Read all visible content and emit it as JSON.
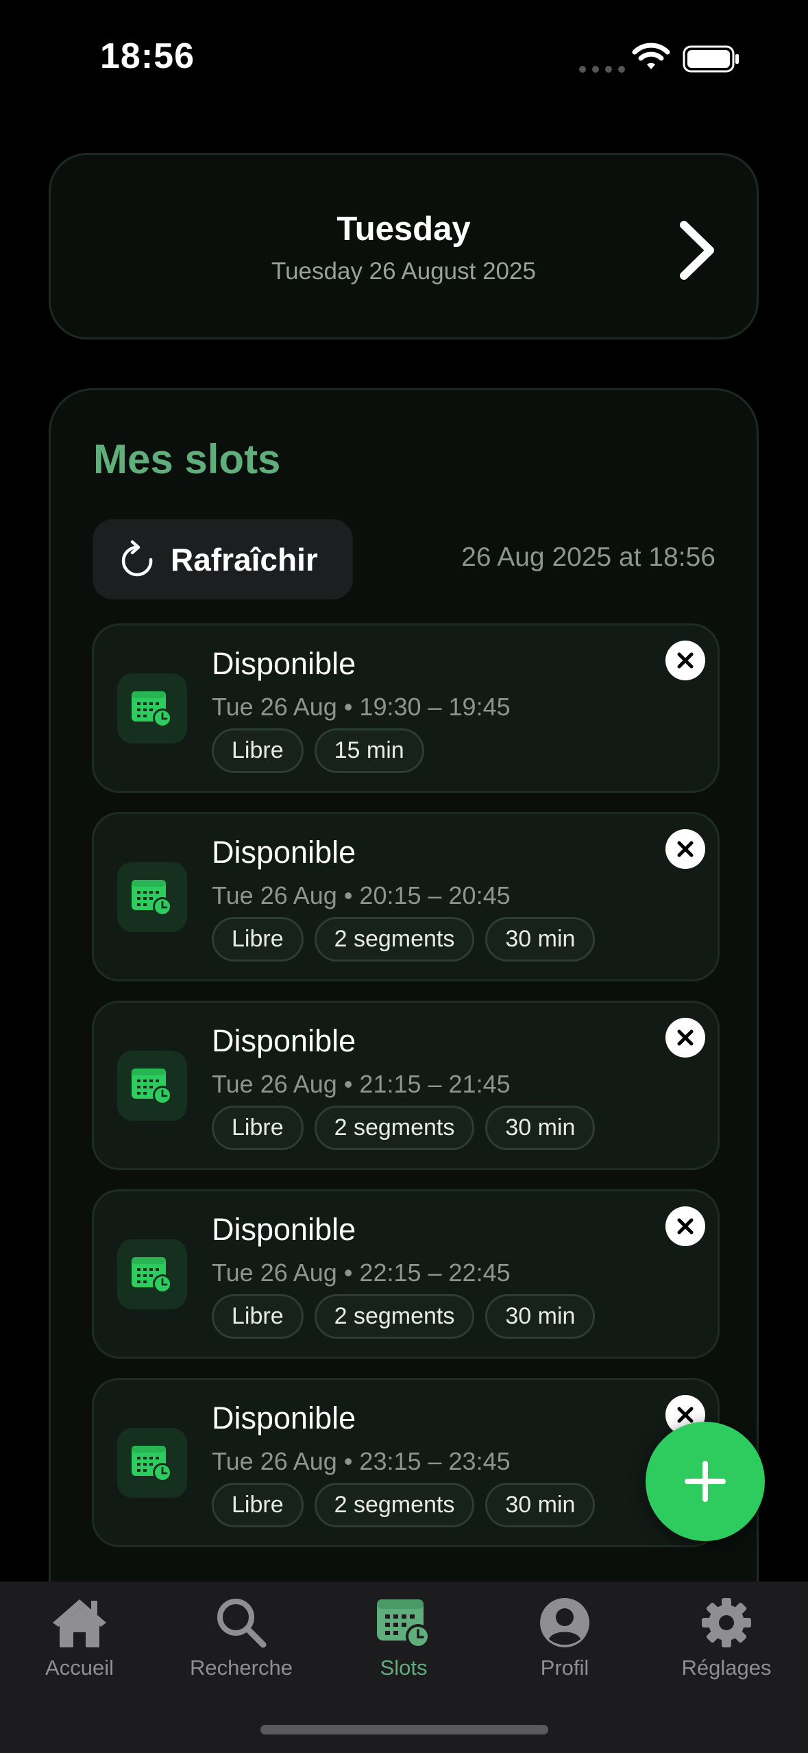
{
  "status_bar": {
    "time": "18:56"
  },
  "day_header": {
    "title": "Tuesday",
    "subtitle": "Tuesday 26 August 2025"
  },
  "slots_section": {
    "title": "Mes slots",
    "refresh_label": "Rafraîchir",
    "last_refreshed": "26 Aug 2025 at 18:56",
    "items": [
      {
        "title": "Disponible",
        "time": "Tue 26 Aug • 19:30 – 19:45",
        "tags": [
          "Libre",
          "15 min"
        ]
      },
      {
        "title": "Disponible",
        "time": "Tue 26 Aug • 20:15 – 20:45",
        "tags": [
          "Libre",
          "2 segments",
          "30 min"
        ]
      },
      {
        "title": "Disponible",
        "time": "Tue 26 Aug • 21:15 – 21:45",
        "tags": [
          "Libre",
          "2 segments",
          "30 min"
        ]
      },
      {
        "title": "Disponible",
        "time": "Tue 26 Aug • 22:15 – 22:45",
        "tags": [
          "Libre",
          "2 segments",
          "30 min"
        ]
      },
      {
        "title": "Disponible",
        "time": "Tue 26 Aug • 23:15 – 23:45",
        "tags": [
          "Libre",
          "2 segments",
          "30 min"
        ]
      }
    ]
  },
  "tab_bar": {
    "tabs": [
      {
        "label": "Accueil",
        "icon": "house-icon"
      },
      {
        "label": "Recherche",
        "icon": "search-icon"
      },
      {
        "label": "Slots",
        "icon": "calendar-clock-icon",
        "active": true
      },
      {
        "label": "Profil",
        "icon": "person-icon"
      },
      {
        "label": "Réglages",
        "icon": "gear-icon"
      }
    ]
  },
  "colors": {
    "accent_green": "#5fae7b",
    "fab_green": "#2ecc5f",
    "background": "#000000",
    "card_background": "#0a0f0c"
  }
}
